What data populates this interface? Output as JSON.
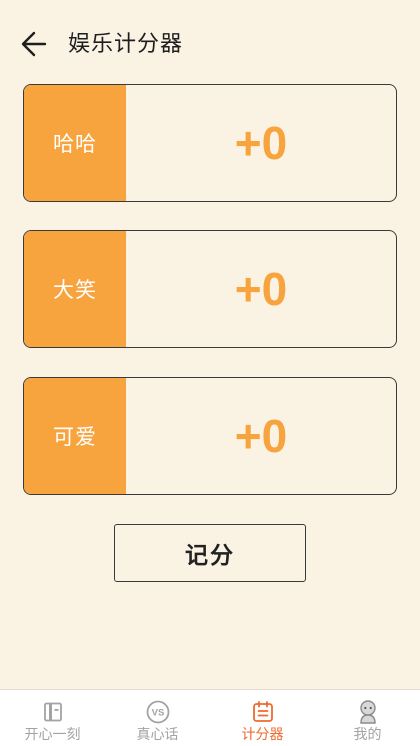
{
  "header": {
    "title": "娱乐计分器",
    "back_icon": "arrow-left-icon"
  },
  "cards": [
    {
      "label": "哈哈",
      "score": "+0"
    },
    {
      "label": "大笑",
      "score": "+0"
    },
    {
      "label": "可爱",
      "score": "+0"
    }
  ],
  "score_button": {
    "label": "记分"
  },
  "bottom_nav": {
    "items": [
      {
        "label": "开心一刻",
        "icon": "book-icon",
        "active": false
      },
      {
        "label": "真心话",
        "icon": "vs-icon",
        "active": false
      },
      {
        "label": "计分器",
        "icon": "calendar-list-icon",
        "active": true
      },
      {
        "label": "我的",
        "icon": "avatar-icon",
        "active": false
      }
    ]
  },
  "colors": {
    "background": "#FAF3E4",
    "accent": "#F7A43E",
    "nav_active": "#EE6A2D",
    "nav_inactive": "#A3A3A3"
  }
}
